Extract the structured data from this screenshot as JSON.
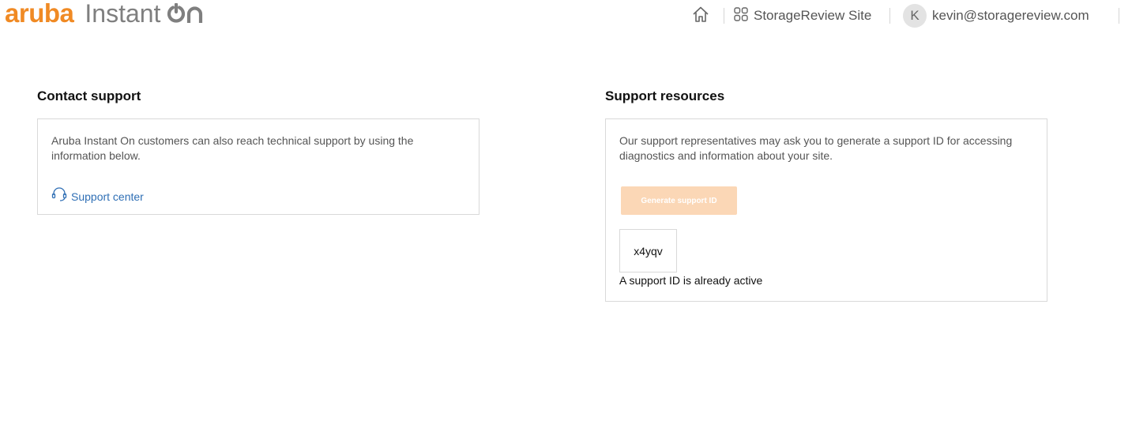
{
  "brand": {
    "name": "aruba",
    "product": "Instant",
    "product_suffix": "ON",
    "colors": {
      "accent": "#f08a24",
      "link": "#2f6fb5",
      "button_disabled": "#fbd7b6"
    }
  },
  "header": {
    "home_icon": "home-icon",
    "site": {
      "icon": "grid-icon",
      "label": "StorageReview Site"
    },
    "user": {
      "initial": "K",
      "email": "kevin@storagereview.com"
    }
  },
  "contact_support": {
    "title": "Contact support",
    "description": "Aruba Instant On customers can also reach technical support by using the information below.",
    "link": {
      "icon": "headset-icon",
      "label": "Support center"
    }
  },
  "support_resources": {
    "title": "Support resources",
    "description": "Our support representatives may ask you to generate a support ID for accessing diagnostics and information about your site.",
    "generate_button": {
      "label": "Generate support ID",
      "disabled": true
    },
    "support_id": "x4yqv",
    "status": "A support ID is already active"
  }
}
